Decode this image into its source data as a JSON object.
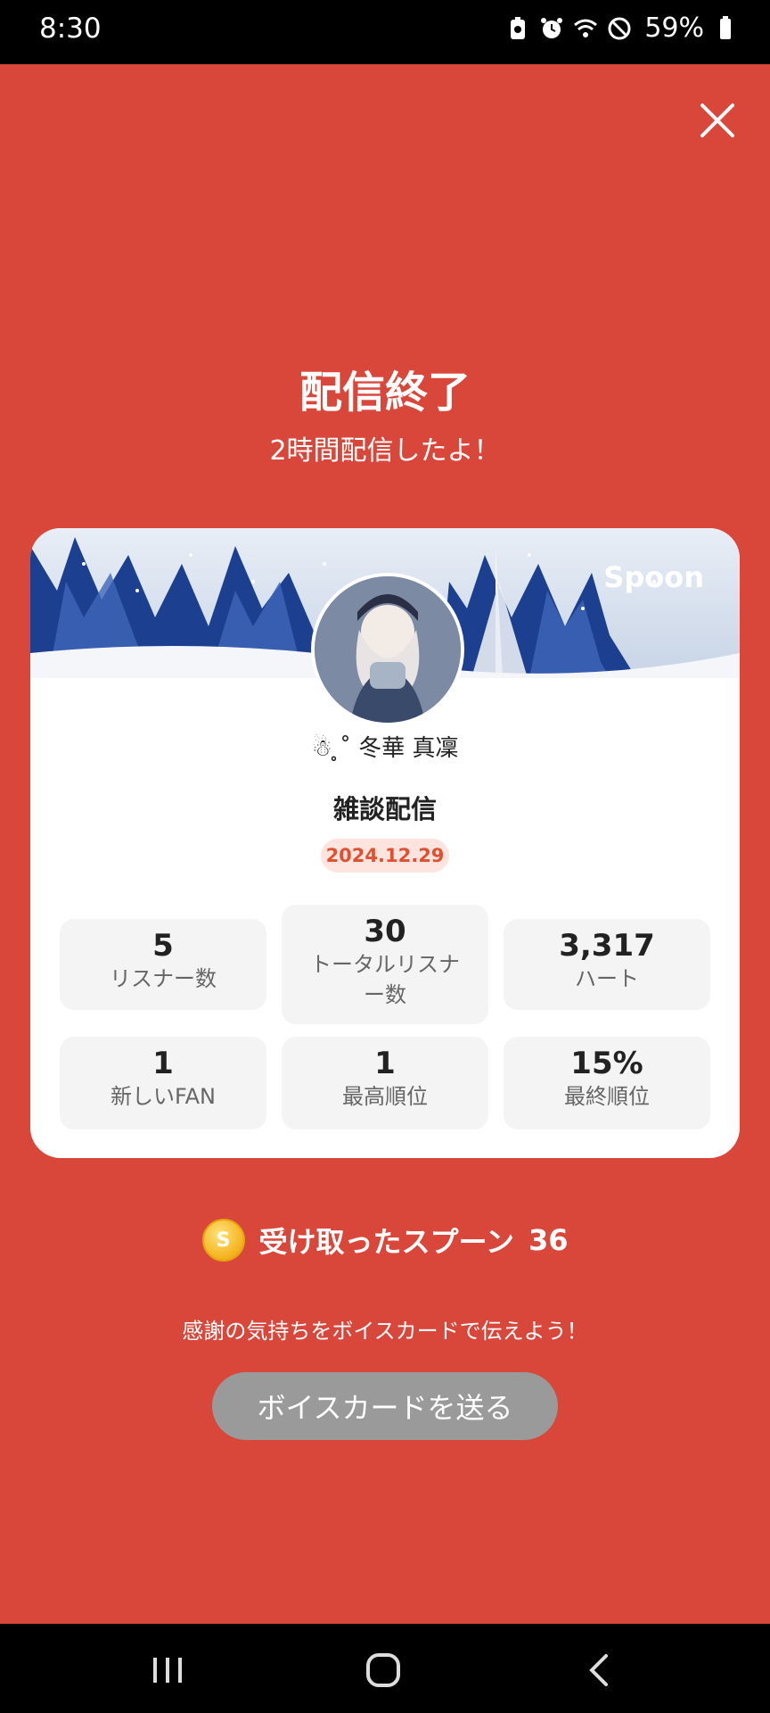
{
  "status_bar": {
    "time": "8:30",
    "battery": "59%"
  },
  "header": {
    "title": "配信終了",
    "subtitle": "2時間配信したよ！"
  },
  "card": {
    "logo": "Spoon",
    "user_name": "☃︎ ̥˚ 冬華 真凜",
    "broadcast_title": "雑談配信",
    "date": "2024.12.29",
    "stats": [
      {
        "value": "5",
        "label": "リスナー数"
      },
      {
        "value": "30",
        "label": "トータルリスナー数"
      },
      {
        "value": "3,317",
        "label": "ハート"
      },
      {
        "value": "1",
        "label": "新しいFAN"
      },
      {
        "value": "1",
        "label": "最高順位"
      },
      {
        "value": "15%",
        "label": "最終順位"
      }
    ]
  },
  "spoons": {
    "coin_symbol": "S",
    "label": "受け取ったスプーン",
    "count": "36"
  },
  "thanks_text": "感謝の気持ちをボイスカードで伝えよう！",
  "voice_button": "ボイスカードを送る",
  "colors": {
    "background": "#d8473a",
    "date_badge_text": "#e2502f",
    "button_disabled": "#9a9a9a"
  }
}
